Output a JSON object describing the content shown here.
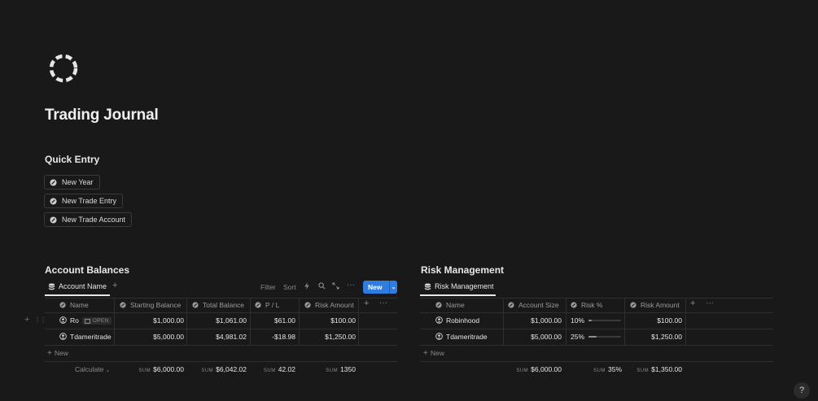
{
  "page": {
    "title": "Trading Journal",
    "icon": "dashed-circle-icon"
  },
  "quick_entry": {
    "heading": "Quick Entry",
    "buttons": [
      "New Year",
      "New Trade Entry",
      "New Trade Account"
    ]
  },
  "account_balances": {
    "heading": "Account Balances",
    "view_tab": "Account Name",
    "toolbar": {
      "filter": "Filter",
      "sort": "Sort",
      "new": "New"
    },
    "columns": [
      "Name",
      "Starting Balance",
      "Total Balance",
      "P / L",
      "Risk Amount"
    ],
    "rows": [
      {
        "name": "Ro",
        "open_label": "OPEN",
        "starting": "$1,000.00",
        "total": "$1,061.00",
        "pl": "$61.00",
        "risk": "$100.00"
      },
      {
        "name": "Tdameritrade",
        "starting": "$5,000.00",
        "total": "$4,981.02",
        "pl": "-$18.98",
        "risk": "$1,250.00"
      }
    ],
    "add_new": "New",
    "calculate": "Calculate",
    "sum_label": "SUM",
    "sums": {
      "starting": "$6,000.00",
      "total": "$6,042.02",
      "pl": "42.02",
      "risk": "1350"
    }
  },
  "risk_management": {
    "heading": "Risk Management",
    "view_tab": "Risk Management",
    "columns": [
      "Name",
      "Account Size",
      "Risk %",
      "Risk Amount"
    ],
    "rows": [
      {
        "name": "Robinhood",
        "size": "$1,000.00",
        "risk_pct": "10%",
        "risk_fraction": 0.1,
        "risk_amount": "$100.00"
      },
      {
        "name": "Tdameritrade",
        "size": "$5,000.00",
        "risk_pct": "25%",
        "risk_fraction": 0.25,
        "risk_amount": "$1,250.00"
      }
    ],
    "add_new": "New",
    "sum_label": "SUM",
    "sums": {
      "size": "$6,000.00",
      "risk_pct": "35%",
      "risk_amount": "$1,350.00"
    }
  },
  "help": "?"
}
